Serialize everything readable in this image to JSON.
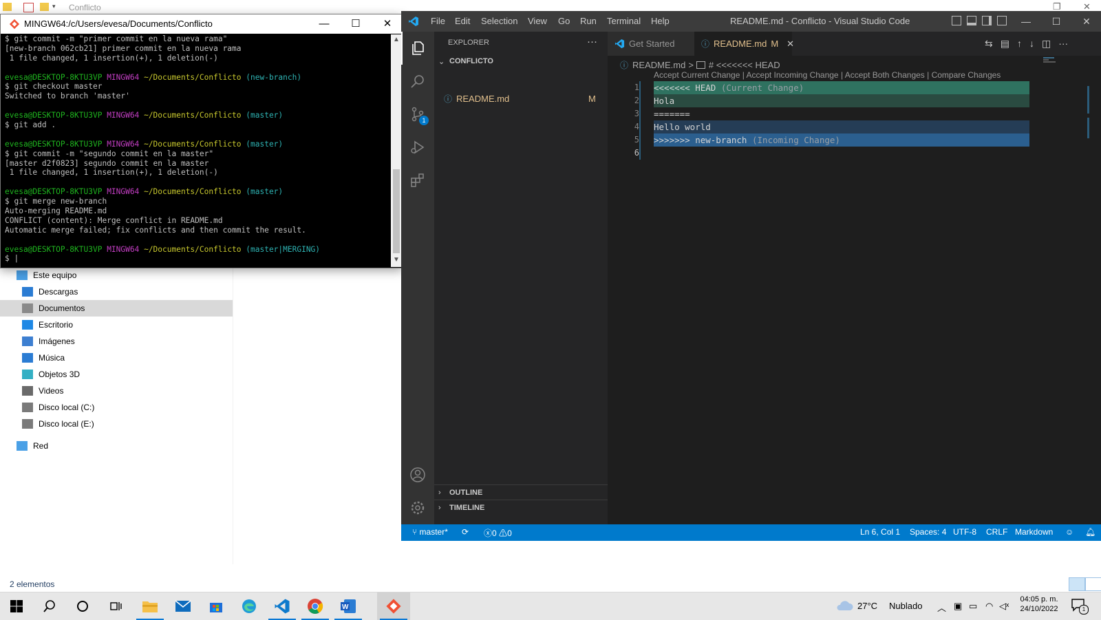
{
  "explorer": {
    "window_title": "Conflicto",
    "nav": [
      {
        "label": "Este equipo",
        "icon": "computer-icon"
      },
      {
        "label": "Descargas",
        "icon": "download-icon"
      },
      {
        "label": "Documentos",
        "icon": "documents-icon"
      },
      {
        "label": "Escritorio",
        "icon": "desktop-icon"
      },
      {
        "label": "Imágenes",
        "icon": "pictures-icon"
      },
      {
        "label": "Música",
        "icon": "music-icon"
      },
      {
        "label": "Objetos 3D",
        "icon": "3d-objects-icon"
      },
      {
        "label": "Videos",
        "icon": "videos-icon"
      },
      {
        "label": "Disco local (C:)",
        "icon": "drive-icon"
      },
      {
        "label": "Disco local (E:)",
        "icon": "drive-icon"
      },
      {
        "label": "Red",
        "icon": "network-icon"
      }
    ],
    "selected_nav": "Documentos",
    "status": "2 elementos"
  },
  "terminal": {
    "title": "MINGW64:/c/Users/evesa/Documents/Conflicto",
    "lines": [
      {
        "parts": [
          {
            "t": "$ git commit -m \"primer commit en la nueva rama\"",
            "c": "w"
          }
        ]
      },
      {
        "parts": [
          {
            "t": "[new-branch 062cb21] primer commit en la nueva rama",
            "c": "w"
          }
        ]
      },
      {
        "parts": [
          {
            "t": " 1 file changed, 1 insertion(+), 1 deletion(-)",
            "c": "w"
          }
        ]
      },
      {
        "parts": []
      },
      {
        "parts": [
          {
            "t": "evesa@DESKTOP-8KTU3VP ",
            "c": "g"
          },
          {
            "t": "MINGW64 ",
            "c": "m"
          },
          {
            "t": "~/Documents/Conflicto ",
            "c": "y"
          },
          {
            "t": "(new-branch)",
            "c": "c"
          }
        ]
      },
      {
        "parts": [
          {
            "t": "$ git checkout master",
            "c": "w"
          }
        ]
      },
      {
        "parts": [
          {
            "t": "Switched to branch 'master'",
            "c": "w"
          }
        ]
      },
      {
        "parts": []
      },
      {
        "parts": [
          {
            "t": "evesa@DESKTOP-8KTU3VP ",
            "c": "g"
          },
          {
            "t": "MINGW64 ",
            "c": "m"
          },
          {
            "t": "~/Documents/Conflicto ",
            "c": "y"
          },
          {
            "t": "(master)",
            "c": "c"
          }
        ]
      },
      {
        "parts": [
          {
            "t": "$ git add .",
            "c": "w"
          }
        ]
      },
      {
        "parts": []
      },
      {
        "parts": [
          {
            "t": "evesa@DESKTOP-8KTU3VP ",
            "c": "g"
          },
          {
            "t": "MINGW64 ",
            "c": "m"
          },
          {
            "t": "~/Documents/Conflicto ",
            "c": "y"
          },
          {
            "t": "(master)",
            "c": "c"
          }
        ]
      },
      {
        "parts": [
          {
            "t": "$ git commit -m \"segundo commit en la master\"",
            "c": "w"
          }
        ]
      },
      {
        "parts": [
          {
            "t": "[master d2f0823] segundo commit en la master",
            "c": "w"
          }
        ]
      },
      {
        "parts": [
          {
            "t": " 1 file changed, 1 insertion(+), 1 deletion(-)",
            "c": "w"
          }
        ]
      },
      {
        "parts": []
      },
      {
        "parts": [
          {
            "t": "evesa@DESKTOP-8KTU3VP ",
            "c": "g"
          },
          {
            "t": "MINGW64 ",
            "c": "m"
          },
          {
            "t": "~/Documents/Conflicto ",
            "c": "y"
          },
          {
            "t": "(master)",
            "c": "c"
          }
        ]
      },
      {
        "parts": [
          {
            "t": "$ git merge new-branch",
            "c": "w"
          }
        ]
      },
      {
        "parts": [
          {
            "t": "Auto-merging README.md",
            "c": "w"
          }
        ]
      },
      {
        "parts": [
          {
            "t": "CONFLICT (content): Merge conflict in README.md",
            "c": "w"
          }
        ]
      },
      {
        "parts": [
          {
            "t": "Automatic merge failed; fix conflicts and then commit the result.",
            "c": "w"
          }
        ]
      },
      {
        "parts": []
      },
      {
        "parts": [
          {
            "t": "evesa@DESKTOP-8KTU3VP ",
            "c": "g"
          },
          {
            "t": "MINGW64 ",
            "c": "m"
          },
          {
            "t": "~/Documents/Conflicto ",
            "c": "y"
          },
          {
            "t": "(master|MERGING)",
            "c": "c"
          }
        ]
      },
      {
        "parts": [
          {
            "t": "$ |",
            "c": "w"
          }
        ]
      }
    ]
  },
  "vscode": {
    "menu": [
      "File",
      "Edit",
      "Selection",
      "View",
      "Go",
      "Run",
      "Terminal",
      "Help"
    ],
    "window_title": "README.md - Conflicto - Visual Studio Code",
    "explorer_header": "EXPLORER",
    "folder": "CONFLICTO",
    "file": {
      "name": "README.md",
      "status": "M"
    },
    "outline": "OUTLINE",
    "timeline": "TIMELINE",
    "tabs": [
      {
        "label": "Get Started",
        "active": false
      },
      {
        "label": "README.md",
        "badge": "M",
        "active": true
      }
    ],
    "breadcrumb": {
      "file": "README.md",
      "sep": ">",
      "symbol": "# <<<<<<< HEAD"
    },
    "codelens": "Accept Current Change | Accept Incoming Change | Accept Both Changes | Compare Changes",
    "code_lines": [
      {
        "num": "1",
        "text": "<<<<<<< HEAD",
        "suffix": " (Current Change)",
        "kind": "cur1"
      },
      {
        "num": "2",
        "text": "Hola",
        "suffix": "",
        "kind": "cur2"
      },
      {
        "num": "3",
        "text": "=======",
        "suffix": "",
        "kind": "none"
      },
      {
        "num": "4",
        "text": "Hello world",
        "suffix": "",
        "kind": "inc2"
      },
      {
        "num": "5",
        "text": ">>>>>>> new-branch",
        "suffix": " (Incoming Change)",
        "kind": "inc1"
      },
      {
        "num": "6",
        "text": "",
        "suffix": "",
        "kind": "none"
      }
    ],
    "source_control_badge": "1",
    "status": {
      "branch": "master*",
      "errors": "0",
      "warnings": "0",
      "position": "Ln 6, Col 1",
      "spaces": "Spaces: 4",
      "encoding": "UTF-8",
      "eol": "CRLF",
      "language": "Markdown"
    }
  },
  "taskbar": {
    "weather": {
      "temp": "27°C",
      "condition": "Nublado"
    },
    "time": "04:05 p. m.",
    "date": "24/10/2022",
    "notification_count": "1"
  },
  "colors": {
    "vscode_status": "#007acc",
    "current_change": "#2f7260",
    "incoming_change": "#2b5f8f",
    "modified_file": "#e2c08d"
  }
}
